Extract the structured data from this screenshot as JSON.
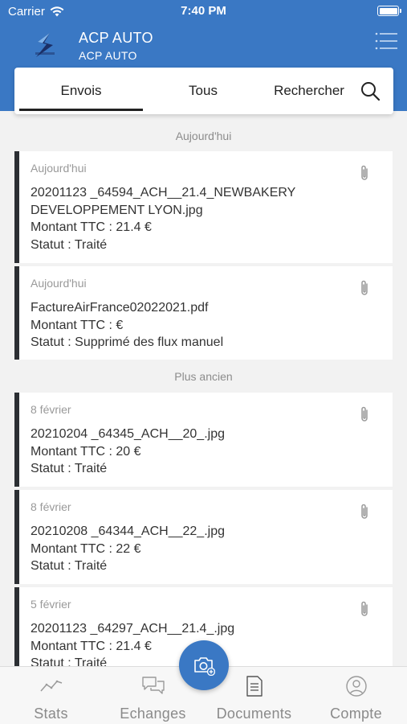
{
  "status_bar": {
    "carrier": "Carrier",
    "time": "7:40 PM"
  },
  "header": {
    "title": "ACP AUTO",
    "subtitle": "ACP AUTO"
  },
  "tabs": {
    "envois": "Envois",
    "tous": "Tous",
    "rechercher": "Rechercher",
    "active": "Envois"
  },
  "sections": {
    "today": "Aujourd'hui",
    "older": "Plus ancien"
  },
  "cards": [
    {
      "date": "Aujourd'hui",
      "line1": "20201123 _64594_ACH__21.4_NEWBAKERY",
      "line2": "DEVELOPPEMENT LYON.jpg",
      "montant": "Montant TTC : 21.4 €",
      "statut": "Statut : Traité"
    },
    {
      "date": "Aujourd'hui",
      "line1": "FactureAirFrance02022021.pdf",
      "montant": "Montant TTC :  €",
      "statut": "Statut : Supprimé des flux manuel"
    },
    {
      "date": "8 février",
      "line1": "20210204 _64345_ACH__20_.jpg",
      "montant": "Montant TTC : 20 €",
      "statut": "Statut : Traité"
    },
    {
      "date": "8 février",
      "line1": "20210208 _64344_ACH__22_.jpg",
      "montant": "Montant TTC : 22 €",
      "statut": "Statut : Traité"
    },
    {
      "date": "5 février",
      "line1": "20201123 _64297_ACH__21.4_.jpg",
      "montant": "Montant TTC : 21.4 €",
      "statut": "Statut : Traité"
    }
  ],
  "bottom_nav": {
    "stats": "Stats",
    "echanges": "Echanges",
    "documents": "Documents",
    "compte": "Compte"
  },
  "icons": {
    "logo": "logo-icon",
    "menu": "menu-lines-icon",
    "search": "search-icon",
    "attachment": "paperclip-icon",
    "stats": "line-chart-icon",
    "echanges": "chat-bubbles-icon",
    "documents": "document-icon",
    "compte": "user-circle-icon",
    "fab": "camera-plus-icon"
  },
  "colors": {
    "brand_blue": "#3a78c4",
    "card_border": "#2c2f33",
    "muted": "#8c8c8c"
  }
}
